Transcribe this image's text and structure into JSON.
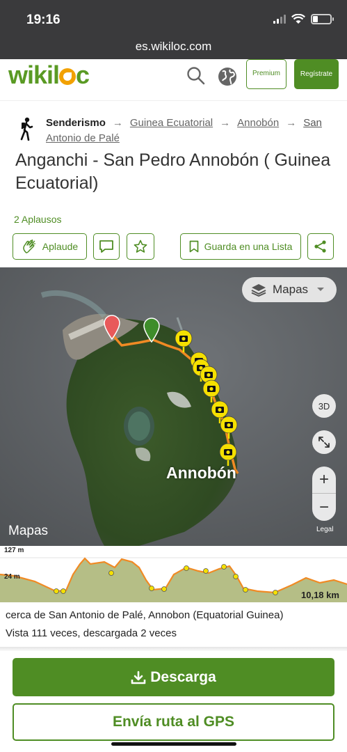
{
  "status_bar": {
    "time": "19:16"
  },
  "browser": {
    "url": "es.wikiloc.com"
  },
  "header": {
    "logo": {
      "pre": "wiki",
      "post": "c",
      "l": "l"
    },
    "premium_label": "Premium",
    "register_label": "Regístrate"
  },
  "breadcrumb": {
    "activity": "Senderismo",
    "country": "Guinea Ecuatorial",
    "region": "Annobón",
    "place_line1": "San",
    "place_line2": "Antonio de Palé"
  },
  "trail": {
    "title": "Anganchi - San Pedro Annobón ( Guinea Ecuatorial)",
    "applause_count": "2 Aplausos"
  },
  "actions": {
    "applaud_label": "Aplaude",
    "save_label": "Guarda en una Lista"
  },
  "map": {
    "layers_label": "Mapas",
    "btn_3d": "3D",
    "zoom_in": "+",
    "zoom_out": "−",
    "legal": "Legal",
    "watermark": "Mapas",
    "place_label": "Annobón",
    "start_pin_color": "#e8595a",
    "end_pin_color": "#3e8d2a",
    "route_color": "#f08a24",
    "photo_marker_color": "#f5e000"
  },
  "elevation": {
    "max": "127 m",
    "min": "24 m",
    "distance": "10,18 km"
  },
  "info": {
    "near": "cerca de San Antonio de Palé, Annobon (Equatorial Guinea)",
    "views": "Vista 111 veces, descargada 2 veces"
  },
  "buttons": {
    "download": "Descarga",
    "send_gps": "Envía ruta al GPS"
  },
  "colors": {
    "brand_green": "#4f8d24",
    "accent_orange": "#f2a100"
  }
}
